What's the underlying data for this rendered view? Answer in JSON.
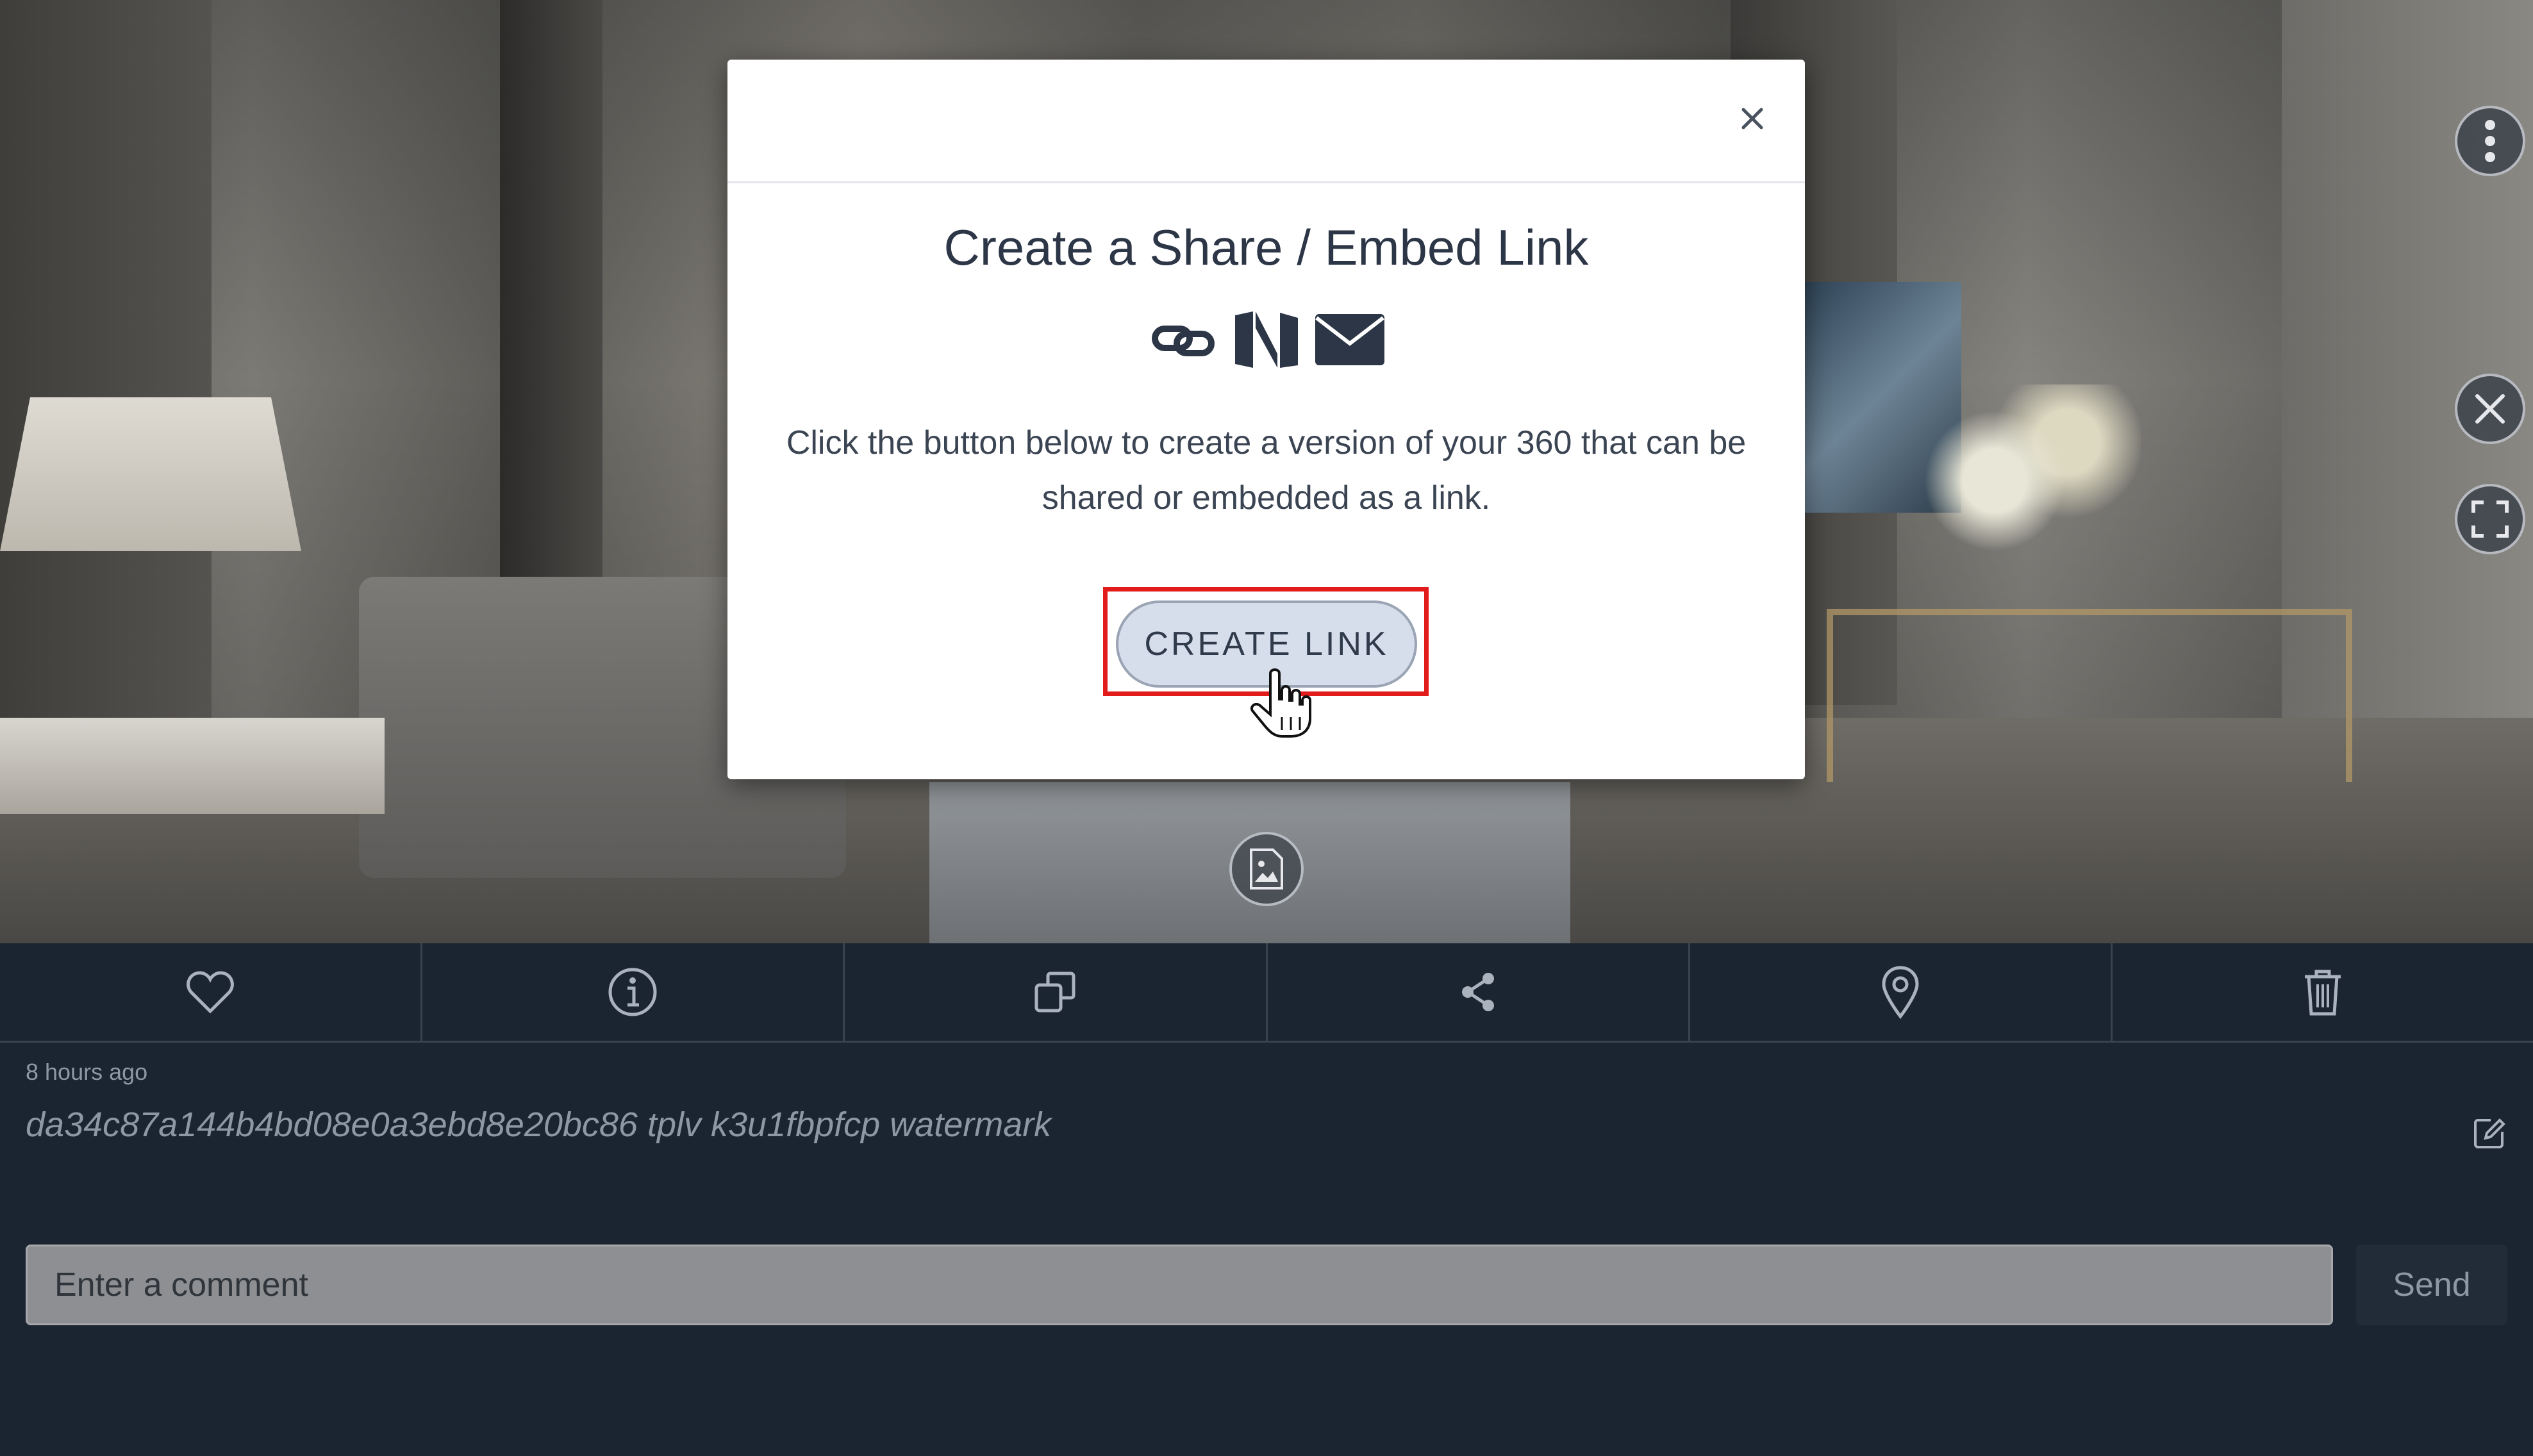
{
  "modal": {
    "title": "Create a Share / Embed Link",
    "description": "Click the button below to create a version of your 360 that can be shared or embedded as a link.",
    "create_button_label": "CREATE LINK",
    "share_icons": [
      "link-icon",
      "medium-icon",
      "envelope-icon"
    ]
  },
  "viewer_controls": [
    "more-options-icon",
    "close-circle-icon",
    "fullscreen-icon"
  ],
  "toolbar": {
    "items": [
      "heart-icon",
      "info-icon",
      "copy-icon",
      "share-icon",
      "location-pin-icon",
      "trash-icon"
    ]
  },
  "meta": {
    "timestamp": "8 hours ago",
    "filename": "da34c87a144b4bd08e0a3ebd8e20bc86 tplv k3u1fbpfcp watermark"
  },
  "comment": {
    "placeholder": "Enter a comment",
    "value": "",
    "send_label": "Send"
  },
  "colors": {
    "panel_bg": "#1b2431",
    "highlight": "#e21b1b",
    "button_bg": "#d7deeb"
  }
}
